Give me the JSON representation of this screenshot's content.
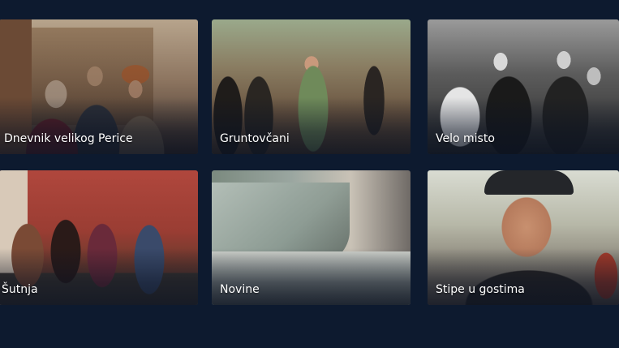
{
  "shows": [
    {
      "title": "Dnevnik velikog Perice"
    },
    {
      "title": "Gruntovčani"
    },
    {
      "title": "Velo misto"
    },
    {
      "title": "Šutnja"
    },
    {
      "title": "Novine"
    },
    {
      "title": "Stipe u gostima"
    }
  ],
  "colors": {
    "background": "#0d1a2f",
    "label_text": "#ffffff"
  }
}
